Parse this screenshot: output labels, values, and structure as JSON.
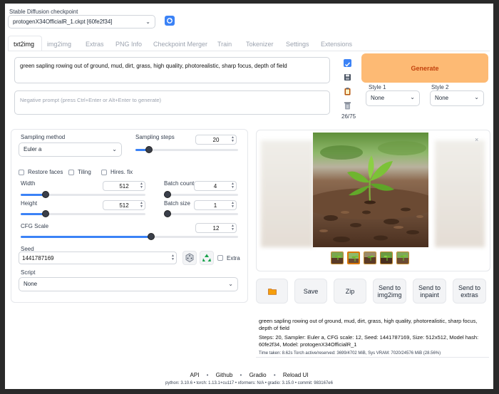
{
  "checkpoint": {
    "label": "Stable Diffusion checkpoint",
    "value": "protogenX34OfficialR_1.ckpt [60fe2f34]"
  },
  "tabs": [
    "txt2img",
    "img2img",
    "Extras",
    "PNG Info",
    "Checkpoint Merger",
    "Train",
    "Tokenizer",
    "Settings",
    "Extensions"
  ],
  "prompt": {
    "value": "green sapling rowing out of ground, mud, dirt, grass, high quality, photorealistic, sharp focus, depth of field",
    "negative_placeholder": "Negative prompt (press Ctrl+Enter or Alt+Enter to generate)"
  },
  "token_count": "26/75",
  "generate_label": "Generate",
  "styles": {
    "style1_label": "Style 1",
    "style1_value": "None",
    "style2_label": "Style 2",
    "style2_value": "None"
  },
  "sampling": {
    "method_label": "Sampling method",
    "method_value": "Euler a",
    "steps_label": "Sampling steps",
    "steps_value": "20",
    "steps_fraction": 0.133
  },
  "options": {
    "restore_faces": "Restore faces",
    "tiling": "Tiling",
    "hires_fix": "Hires. fix"
  },
  "width": {
    "label": "Width",
    "value": "512",
    "fraction": 0.2
  },
  "height": {
    "label": "Height",
    "value": "512",
    "fraction": 0.2
  },
  "batch_count": {
    "label": "Batch count",
    "value": "4",
    "fraction": 0.03
  },
  "batch_size": {
    "label": "Batch size",
    "value": "1",
    "fraction": 0.0
  },
  "cfg": {
    "label": "CFG Scale",
    "value": "12",
    "fraction": 0.6
  },
  "seed": {
    "label": "Seed",
    "value": "1441787169",
    "extra_label": "Extra"
  },
  "script": {
    "label": "Script",
    "value": "None"
  },
  "actions": {
    "save": "Save",
    "zip": "Zip",
    "send_img2img": "Send to img2img",
    "send_inpaint": "Send to inpaint",
    "send_extras": "Send to extras"
  },
  "output_info": {
    "prompt": "green sapling rowing out of ground, mud, dirt, grass, high quality, photorealistic, sharp focus, depth of field",
    "params": "Steps: 20, Sampler: Euler a, CFG scale: 12, Seed: 1441787169, Size: 512x512, Model hash: 60fe2f34, Model: protogenX34OfficialR_1",
    "timing": "Time taken: 8.62s  Torch active/reserved: 3699/4702 MiB, Sys VRAM: 7020/24576 MiB (28.56%)"
  },
  "footer": {
    "links": [
      "API",
      "Github",
      "Gradio",
      "Reload UI"
    ],
    "versions": "python: 3.10.6  •  torch: 1.13.1+cu117  •  xformers: N/A  •  gradio: 3.15.0  •  commit: 983167e6"
  },
  "colors": {
    "accent": "#3b82f6",
    "generate_bg": "#fdba74",
    "generate_text": "#c2410c"
  }
}
